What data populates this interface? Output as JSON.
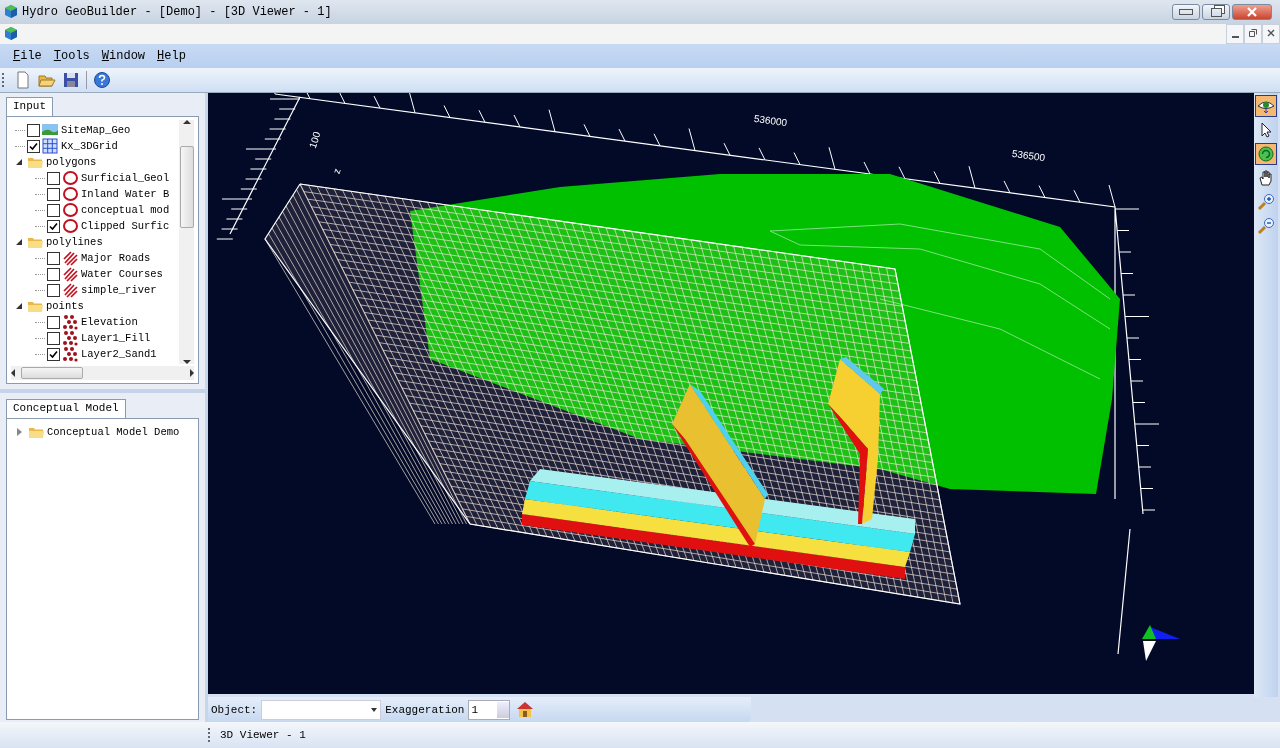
{
  "window": {
    "title": "Hydro GeoBuilder - [Demo] - [3D Viewer - 1]"
  },
  "menu": [
    "File",
    "Tools",
    "Window",
    "Help"
  ],
  "toolbar": [
    {
      "kind": "new"
    },
    {
      "kind": "open"
    },
    {
      "kind": "save"
    },
    {
      "kind": "help"
    }
  ],
  "input_panel": {
    "tab": "Input",
    "tree": [
      {
        "label": "SiteMap_Geo",
        "kind": "image",
        "checked": false
      },
      {
        "label": "Kx_3DGrid",
        "kind": "grid",
        "checked": true
      },
      {
        "label": "polygons",
        "kind": "folder",
        "expanded": true,
        "children": [
          {
            "label": "Surficial_Geol",
            "kind": "polygon",
            "checked": false
          },
          {
            "label": "Inland Water B",
            "kind": "polygon",
            "checked": false
          },
          {
            "label": "conceptual mod",
            "kind": "polygon",
            "checked": false
          },
          {
            "label": "Clipped Surfic",
            "kind": "polygon",
            "checked": true
          }
        ]
      },
      {
        "label": "polylines",
        "kind": "folder",
        "expanded": true,
        "children": [
          {
            "label": "Major Roads",
            "kind": "polyline",
            "checked": false
          },
          {
            "label": "Water Courses",
            "kind": "polyline",
            "checked": false
          },
          {
            "label": "simple_river",
            "kind": "polyline",
            "checked": false
          }
        ]
      },
      {
        "label": "points",
        "kind": "folder",
        "expanded": true,
        "children": [
          {
            "label": "Elevation",
            "kind": "point",
            "checked": false
          },
          {
            "label": "Layer1_Fill",
            "kind": "point",
            "checked": false
          },
          {
            "label": "Layer2_Sand1",
            "kind": "point",
            "checked": true
          }
        ]
      }
    ]
  },
  "model_panel": {
    "tab": "Conceptual Model",
    "tree": [
      {
        "label": "Conceptual Model Demo",
        "kind": "folder",
        "expanded": false
      }
    ]
  },
  "viewer": {
    "axis_labels": [
      "536000",
      "536500",
      "100",
      "z"
    ],
    "tools": [
      {
        "kind": "eye",
        "on": true
      },
      {
        "kind": "pointer",
        "on": false
      },
      {
        "kind": "rotate",
        "on": true
      },
      {
        "kind": "hand",
        "on": false
      },
      {
        "kind": "zoom-in",
        "on": false
      },
      {
        "kind": "zoom-out",
        "on": false
      }
    ],
    "object_label": "Object:",
    "exaggeration_label": "Exaggeration",
    "exaggeration_value": "1"
  },
  "status_bar": {
    "tab": "3D Viewer - 1"
  }
}
